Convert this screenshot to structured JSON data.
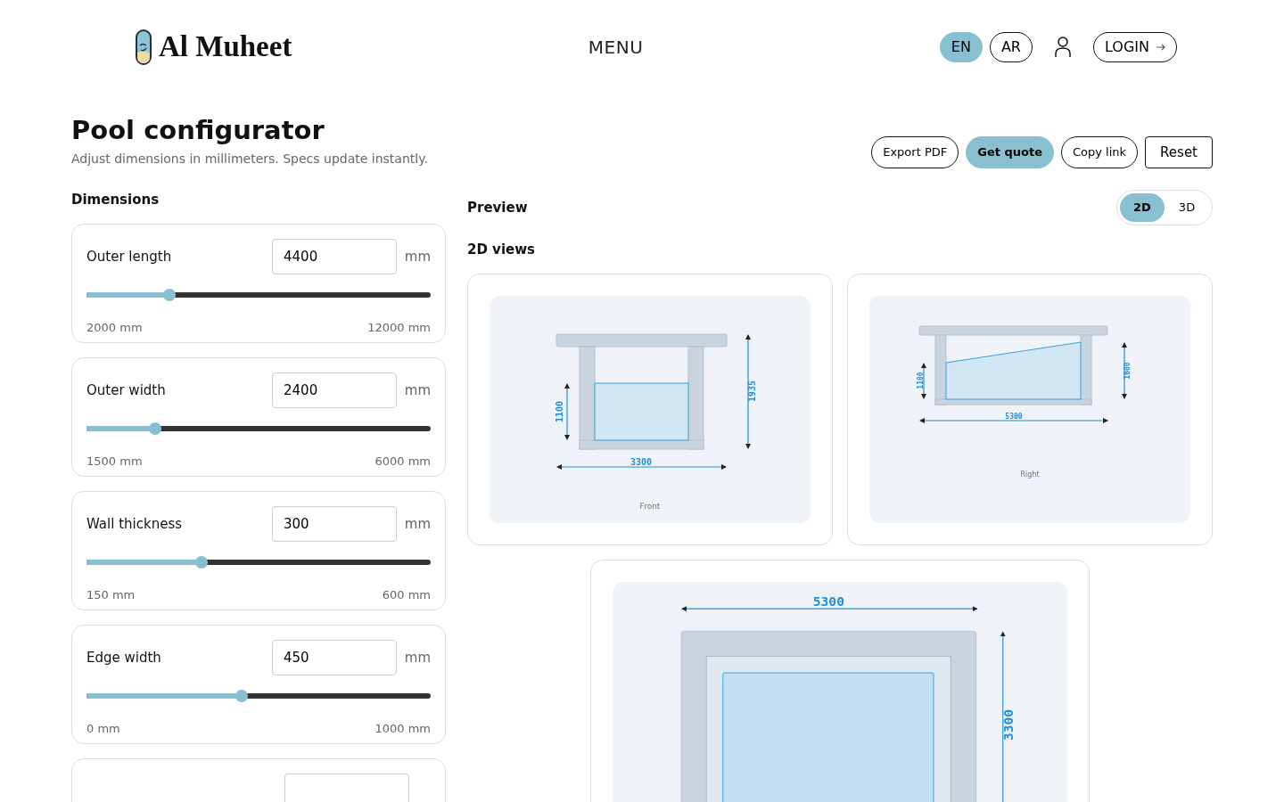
{
  "header": {
    "brand": "Al Muheet",
    "menu": "MENU",
    "languages": [
      {
        "label": "EN",
        "selected": true
      },
      {
        "label": "AR",
        "selected": false
      }
    ],
    "login": "LOGIN"
  },
  "page": {
    "title": "Pool configurator",
    "subtitle": "Adjust dimensions in millimeters. Specs update instantly."
  },
  "actions": [
    {
      "label": "Export PDF",
      "kind": "pill"
    },
    {
      "label": "Get quote",
      "kind": "primary"
    },
    {
      "label": "Copy link",
      "kind": "pill"
    },
    {
      "label": "Reset",
      "kind": "square"
    }
  ],
  "dimensions": {
    "heading": "Dimensions",
    "fields": [
      {
        "kind": "slider",
        "label": "Outer length",
        "value": "4400",
        "unit": "mm",
        "level": 0.24,
        "min": "2000 mm",
        "max": "12000 mm"
      },
      {
        "kind": "slider",
        "label": "Outer width",
        "value": "2400",
        "unit": "mm",
        "level": 0.2,
        "min": "1500 mm",
        "max": "6000 mm"
      },
      {
        "kind": "slider",
        "label": "Wall thickness",
        "value": "300",
        "unit": "mm",
        "level": 0.333,
        "min": "150 mm",
        "max": "600 mm"
      },
      {
        "kind": "slider",
        "label": "Edge width",
        "value": "450",
        "unit": "mm",
        "level": 0.45,
        "min": "0 mm",
        "max": "1000 mm"
      },
      {
        "kind": "cut"
      }
    ]
  },
  "preview": {
    "heading": "Preview",
    "modes": [
      {
        "label": "2D",
        "selected": true
      },
      {
        "label": "3D",
        "selected": false
      }
    ],
    "views_heading": "2D views",
    "views": [
      {
        "kind": "front",
        "caption": "Front",
        "dims": [
          "1100",
          "1935",
          "3300"
        ]
      },
      {
        "kind": "right",
        "caption": "Right",
        "dims": [
          "1100",
          "1600",
          "5300"
        ]
      },
      {
        "kind": "top",
        "dims": [
          "5300",
          "3300"
        ]
      }
    ]
  }
}
